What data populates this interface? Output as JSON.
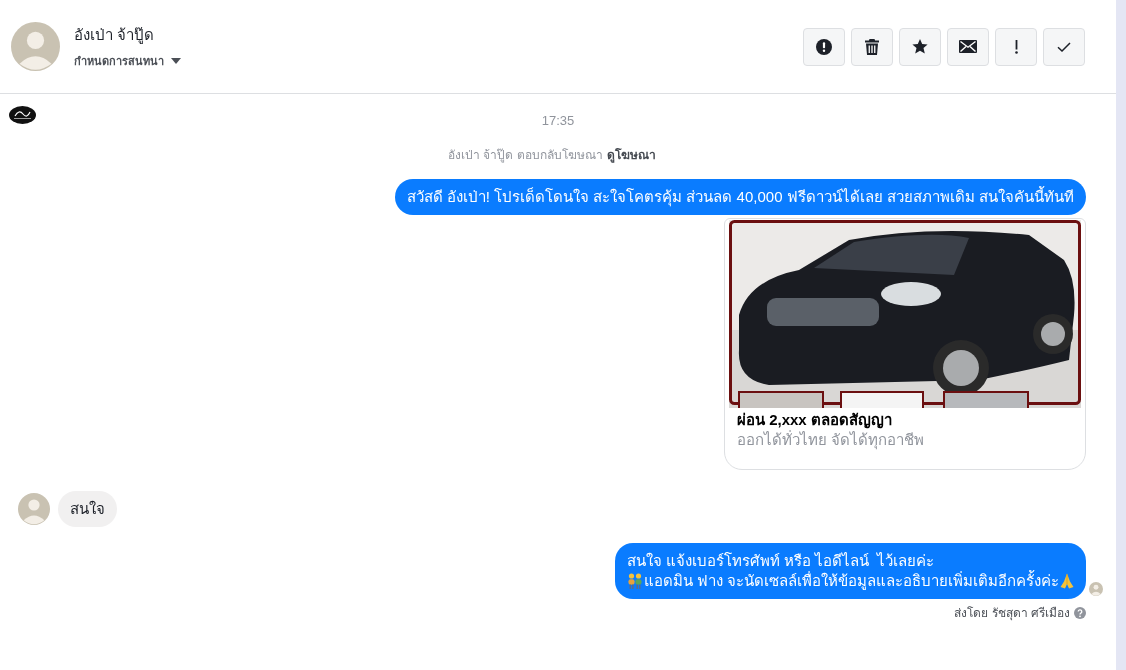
{
  "header": {
    "name": "อังเป่า จ้าปู๊ด",
    "subtitle": "กำหนดการสนทนา",
    "actions": [
      {
        "kind": "alert"
      },
      {
        "kind": "delete"
      },
      {
        "kind": "star"
      },
      {
        "kind": "mail"
      },
      {
        "kind": "important"
      },
      {
        "kind": "done"
      }
    ]
  },
  "thread": {
    "timestamp": "17:35",
    "ad_reply": {
      "text": "อังเป่า จ้าปู๊ด ตอบกลับโฆษณา",
      "link": "ดูโฆษณา"
    },
    "messages": [
      {
        "kind": "outgoing",
        "seen": false,
        "lines": [
          [
            {
              "kind": "text",
              "text": "สวัสดี อังเป่า! โปรเด็ดโดนใจ สะใจโคตรคุ้ม ส่วนลด 40,000 ฟรีดาวน์ได้เลย สวยสภาพเดิม สนใจคันนี้ทันที"
            }
          ]
        ]
      },
      {
        "kind": "ad_card",
        "title": "ผ่อน 2,xxx ตลอดสัญญา",
        "subtitle": "ออกได้ทั่วไทย จัดได้ทุกอาชีพ"
      },
      {
        "kind": "incoming",
        "lines": [
          [
            {
              "kind": "text",
              "text": "สนใจ"
            }
          ]
        ]
      },
      {
        "kind": "outgoing",
        "seen": true,
        "lines": [
          [
            {
              "kind": "text",
              "text": "สนใจ แจ้งเบอร์โทรศัพท์ หรือ ไอดีไลน์  ไว้เลยค่ะ"
            }
          ],
          [
            {
              "kind": "people_emoji"
            },
            {
              "kind": "text",
              "text": "แอดมิน ฟาง จะนัดเซลล์เพื่อให้ข้อมูลและอธิบายเพิ่มเติมอีกครั้งค่ะ"
            },
            {
              "kind": "pray_emoji"
            }
          ]
        ],
        "sent_by": "ส่งโดย รัชสุดา ศรีเมือง"
      }
    ]
  }
}
